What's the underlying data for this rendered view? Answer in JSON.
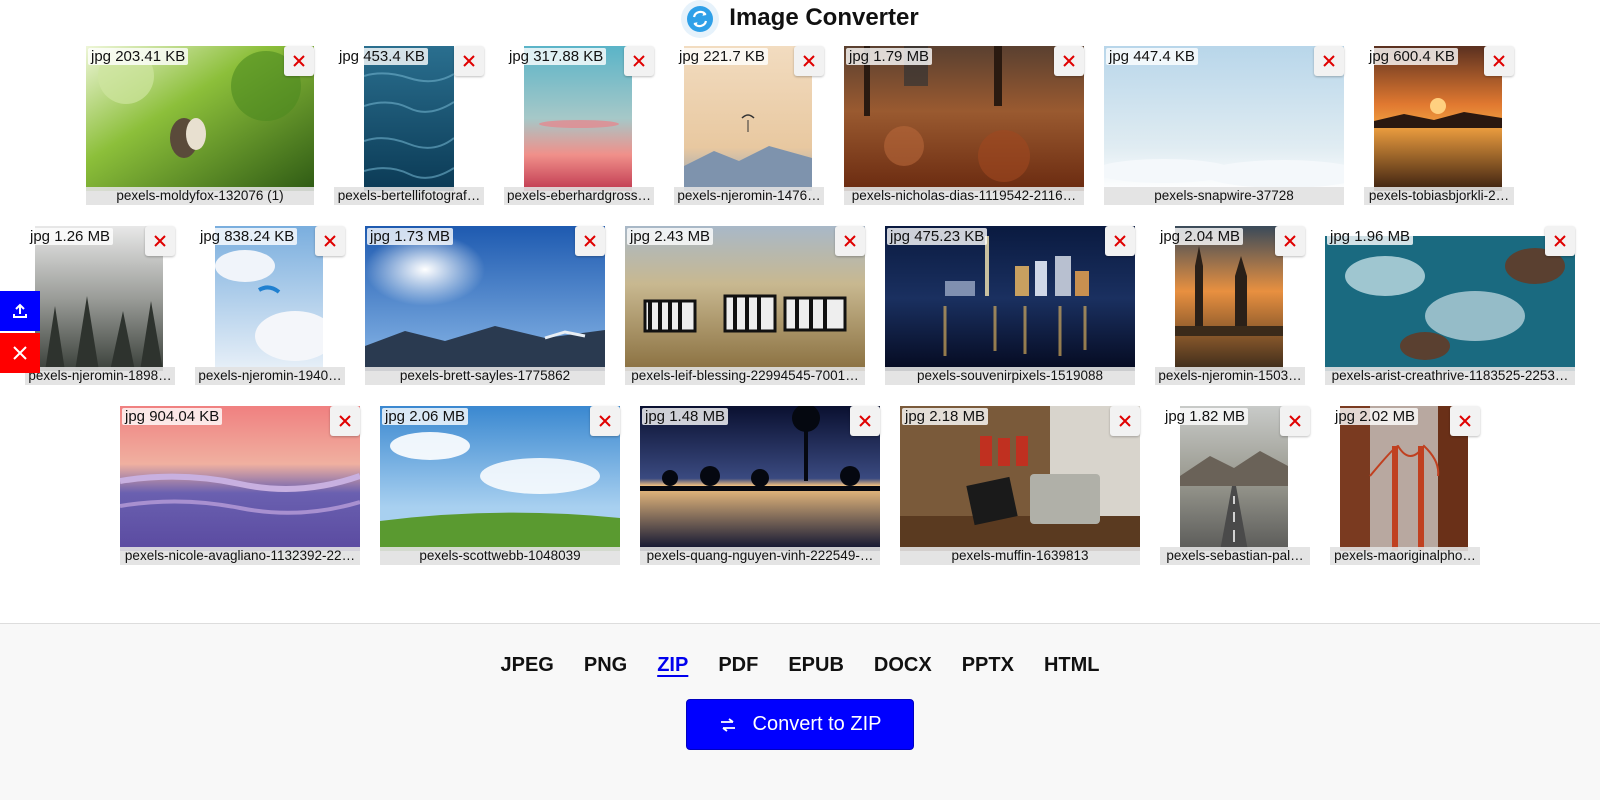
{
  "app": {
    "title": "Image Converter",
    "logo_icon": "convert-arrows-icon"
  },
  "colors": {
    "accent": "#0000ff",
    "remove_x": "#e00000",
    "delete_all_bg": "#ff0000"
  },
  "images": [
    {
      "format": "jpg",
      "size": "203.41 KB",
      "filename": "pexels-moldyfox-132076 (1)"
    },
    {
      "format": "jpg",
      "size": "453.4 KB",
      "filename": "pexels-bertellifotograf…"
    },
    {
      "format": "jpg",
      "size": "317.88 KB",
      "filename": "pexels-eberhardgross…"
    },
    {
      "format": "jpg",
      "size": "221.7 KB",
      "filename": "pexels-njeromin-1476…"
    },
    {
      "format": "jpg",
      "size": "1.79 MB",
      "filename": "pexels-nicholas-dias-1119542-2116…"
    },
    {
      "format": "jpg",
      "size": "447.4 KB",
      "filename": "pexels-snapwire-37728"
    },
    {
      "format": "jpg",
      "size": "600.4 KB",
      "filename": "pexels-tobiasbjorkli-2…"
    },
    {
      "format": "jpg",
      "size": "1.26 MB",
      "filename": "pexels-njeromin-1898…"
    },
    {
      "format": "jpg",
      "size": "838.24 KB",
      "filename": "pexels-njeromin-1940…"
    },
    {
      "format": "jpg",
      "size": "1.73 MB",
      "filename": "pexels-brett-sayles-1775862"
    },
    {
      "format": "jpg",
      "size": "2.43 MB",
      "filename": "pexels-leif-blessing-22994545-7001…"
    },
    {
      "format": "jpg",
      "size": "475.23 KB",
      "filename": "pexels-souvenirpixels-1519088"
    },
    {
      "format": "jpg",
      "size": "2.04 MB",
      "filename": "pexels-njeromin-1503…"
    },
    {
      "format": "jpg",
      "size": "1.96 MB",
      "filename": "pexels-arist-creathrive-1183525-2253…"
    },
    {
      "format": "jpg",
      "size": "904.04 KB",
      "filename": "pexels-nicole-avagliano-1132392-22…"
    },
    {
      "format": "jpg",
      "size": "2.06 MB",
      "filename": "pexels-scottwebb-1048039"
    },
    {
      "format": "jpg",
      "size": "1.48 MB",
      "filename": "pexels-quang-nguyen-vinh-222549-…"
    },
    {
      "format": "jpg",
      "size": "2.18 MB",
      "filename": "pexels-muffin-1639813"
    },
    {
      "format": "jpg",
      "size": "1.82 MB",
      "filename": "pexels-sebastian-pal…"
    },
    {
      "format": "jpg",
      "size": "2.02 MB",
      "filename": "pexels-maoriginalpho…"
    }
  ],
  "side_actions": {
    "upload_icon": "upload-icon",
    "clear_icon": "close-icon"
  },
  "formats": {
    "items": [
      "JPEG",
      "PNG",
      "ZIP",
      "PDF",
      "EPUB",
      "DOCX",
      "PPTX",
      "HTML"
    ],
    "selected": "ZIP"
  },
  "convert_button": {
    "label": "Convert to ZIP",
    "icon": "swap-arrows-icon"
  }
}
